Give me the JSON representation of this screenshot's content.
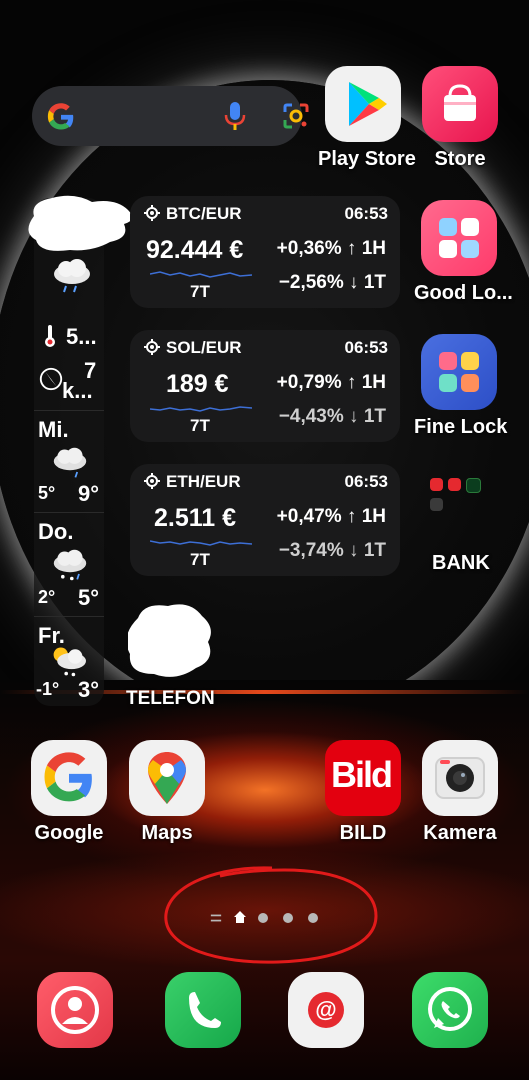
{
  "search": {
    "g_icon": "google-g-icon",
    "mic_icon": "mic-icon",
    "lens_icon": "lens-icon"
  },
  "top_apps": [
    {
      "label": "Play Store",
      "icon": "play-store-icon"
    },
    {
      "label": "Store",
      "icon": "store-bag-icon"
    }
  ],
  "crypto_widgets": [
    {
      "pair": "BTC/EUR",
      "time": "06:53",
      "price": "92.444 €",
      "change_1h": "+0,36% ↑ 1H",
      "change_1t": "−2,56% ↓ 1T",
      "range": "7T"
    },
    {
      "pair": "SOL/EUR",
      "time": "06:53",
      "price": "189 €",
      "change_1h": "+0,79% ↑ 1H",
      "change_1t": "−4,43% ↓ 1T",
      "range": "7T"
    },
    {
      "pair": "ETH/EUR",
      "time": "06:53",
      "price": "2.511 €",
      "change_1h": "+0,47% ↑ 1H",
      "change_1t": "−3,74% ↓ 1T",
      "range": "7T"
    }
  ],
  "right_apps": [
    {
      "label": "Good Lo...",
      "icon": "good-lock-icon"
    },
    {
      "label": "Fine Lock",
      "icon": "fine-lock-icon"
    },
    {
      "label": "BANK",
      "icon": "bank-folder-icon"
    }
  ],
  "weather": {
    "temp_now": "5...",
    "wind_value": "7",
    "wind_unit": "k...",
    "days": [
      {
        "day": "Mi.",
        "low": "5°",
        "high": "9°",
        "icon": "rain-cloud-icon"
      },
      {
        "day": "Do.",
        "low": "2°",
        "high": "5°",
        "icon": "snow-cloud-icon"
      },
      {
        "day": "Fr.",
        "low": "-1°",
        "high": "3°",
        "icon": "sun-snow-cloud-icon"
      }
    ]
  },
  "telefon_label": "TELEFON",
  "row_apps": [
    {
      "label": "Google",
      "icon": "google-icon"
    },
    {
      "label": "Maps",
      "icon": "maps-icon"
    },
    {
      "label": "BILD",
      "icon": "bild-icon",
      "icon_text": "Bild"
    },
    {
      "label": "Kamera",
      "icon": "camera-icon"
    }
  ],
  "dock": [
    {
      "name": "contacts",
      "icon": "contacts-icon"
    },
    {
      "name": "phone",
      "icon": "phone-icon"
    },
    {
      "name": "email",
      "icon": "email-icon"
    },
    {
      "name": "whatsapp",
      "icon": "whatsapp-icon"
    }
  ],
  "colors": {
    "accent_red": "#e5292f",
    "widget_bg": "#1a1a1b",
    "search_bg": "#2c2d31",
    "annotation_red": "#e11a1a"
  }
}
